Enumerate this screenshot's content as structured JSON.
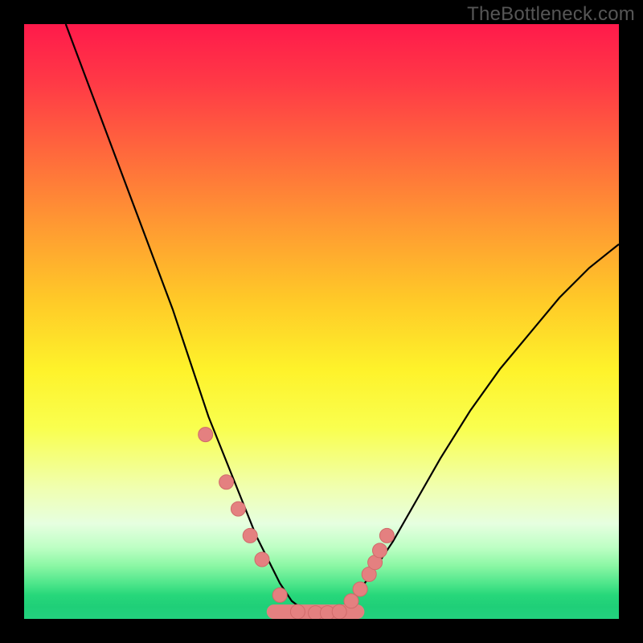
{
  "watermark": "TheBottleneck.com",
  "colors": {
    "frame": "#000000",
    "curve_stroke": "#000000",
    "marker_fill": "#e48080",
    "marker_stroke": "#d06a6a",
    "gradient_top": "#ff1a4b",
    "gradient_bottom": "#23d17e"
  },
  "chart_data": {
    "type": "line",
    "title": "",
    "xlabel": "",
    "ylabel": "",
    "xlim": [
      0,
      100
    ],
    "ylim": [
      0,
      100
    ],
    "grid": false,
    "legend": false,
    "series": [
      {
        "name": "bottleneck-curve",
        "x": [
          7,
          10,
          13,
          16,
          19,
          22,
          25,
          27,
          29,
          31,
          33,
          35,
          37,
          39,
          41,
          43,
          45,
          47,
          49,
          51,
          53,
          55,
          58,
          62,
          66,
          70,
          75,
          80,
          85,
          90,
          95,
          100
        ],
        "y": [
          100,
          92,
          84,
          76,
          68,
          60,
          52,
          46,
          40,
          34,
          29,
          24,
          19,
          14,
          10,
          6,
          3,
          1.5,
          1,
          1,
          1.5,
          3,
          7,
          13,
          20,
          27,
          35,
          42,
          48,
          54,
          59,
          63
        ]
      }
    ],
    "markers": {
      "name": "highlighted-points",
      "x": [
        30.5,
        34,
        36,
        38,
        40,
        43,
        46,
        49,
        51,
        53,
        55,
        56.5,
        58,
        59,
        59.8,
        61
      ],
      "y": [
        31,
        23,
        18.5,
        14,
        10,
        4,
        1.2,
        1,
        1,
        1.2,
        3,
        5,
        7.5,
        9.5,
        11.5,
        14
      ]
    },
    "bottom_band": {
      "name": "optimal-range",
      "x_start": 42,
      "x_end": 56,
      "y": 1.2
    }
  }
}
